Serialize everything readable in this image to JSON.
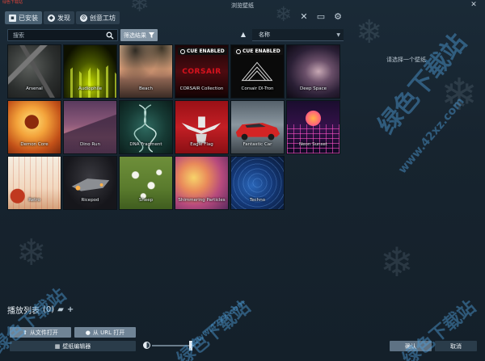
{
  "window": {
    "title": "浏览壁纸",
    "close_glyph": "✕"
  },
  "tabs": [
    {
      "label": "已安装",
      "icon": "save-icon",
      "active": true
    },
    {
      "label": "发现",
      "icon": "compass-icon",
      "active": false
    },
    {
      "label": "创意工坊",
      "icon": "steam-icon",
      "active": false
    }
  ],
  "toolbar_icons": [
    "tools-icon",
    "monitor-icon",
    "gear-icon"
  ],
  "search": {
    "placeholder": "搜索"
  },
  "filter": {
    "label": "筛选结果"
  },
  "sort": {
    "direction_glyph": "▲",
    "value": "名称"
  },
  "wallpapers": [
    {
      "name": "Arsenal",
      "cue": false
    },
    {
      "name": "Audiophile",
      "cue": false
    },
    {
      "name": "Beach",
      "cue": false
    },
    {
      "name": "CORSAIR Collection",
      "cue": true,
      "brand_text": "CORSAIR"
    },
    {
      "name": "Corsair Dl-Tron",
      "cue": true
    },
    {
      "name": "Deep Space",
      "cue": false
    },
    {
      "name": "Demon Core",
      "cue": false
    },
    {
      "name": "Dino Run",
      "cue": false
    },
    {
      "name": "DNA Fragment",
      "cue": false
    },
    {
      "name": "Eagle Flag",
      "cue": false
    },
    {
      "name": "Fantastic Car",
      "cue": false
    },
    {
      "name": "Neon Sunset",
      "cue": false
    },
    {
      "name": "Retro",
      "cue": false
    },
    {
      "name": "Ricepod",
      "cue": false
    },
    {
      "name": "Sheep",
      "cue": false
    },
    {
      "name": "Shimmering Particles",
      "cue": false
    },
    {
      "name": "Techno",
      "cue": false
    }
  ],
  "cue_badge": "CUE ENABLED",
  "preview_hint": "请选择一个壁纸",
  "playlist": {
    "label": "播放列表",
    "count": "(0)"
  },
  "buttons": {
    "open_file": "从文件打开",
    "open_url": "从 URL 打开",
    "editor": "壁纸编辑器",
    "confirm": "确认",
    "cancel": "取消"
  },
  "brightness": {
    "level": 0.95
  },
  "watermarks": [
    "绿色下载站",
    "www.42xz.com",
    "绿色下载站",
    "www.42xz.com",
    "绿色下载站",
    "绿色下载站"
  ],
  "logo_text": "绿色下载站"
}
